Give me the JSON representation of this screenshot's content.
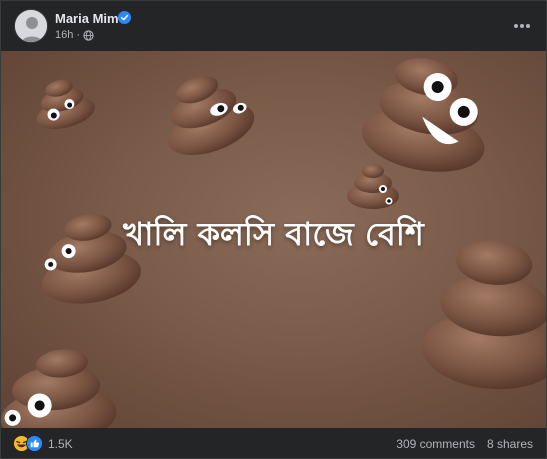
{
  "post": {
    "author": "Maria Mim",
    "time": "16h",
    "privacy_icon": "globe-icon",
    "more_icon": "more-horizontal-icon",
    "verified_icon": "verified-badge-icon"
  },
  "media": {
    "caption": "খালি কলসি বাজে বেশি",
    "background_color": "#7a5a48",
    "emoji_color": "#7b5543"
  },
  "footer": {
    "reaction_icons": [
      "haha-icon",
      "like-icon"
    ],
    "reaction_count": "1.5K",
    "comments": "309 comments",
    "shares": "8 shares"
  },
  "colors": {
    "card_bg": "#242526",
    "text_primary": "#e4e6eb",
    "text_secondary": "#b0b3b8",
    "verified_blue": "#2d88ff"
  }
}
